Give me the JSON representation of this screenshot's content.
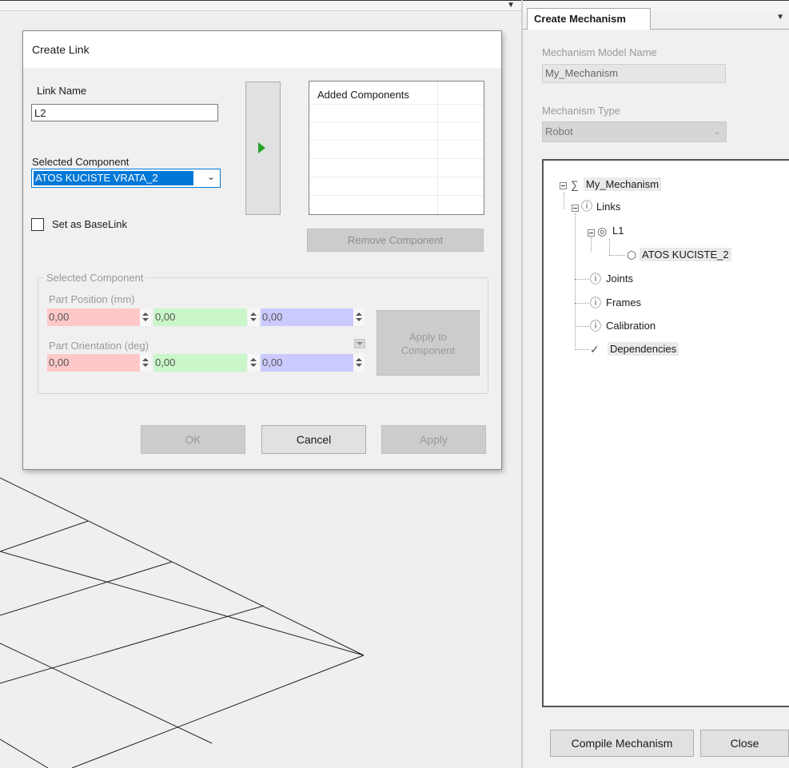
{
  "dialog": {
    "title": "Create Link",
    "link_name_label": "Link Name",
    "link_name_value": "L2",
    "selected_component_label": "Selected Component",
    "selected_component_value": "ATOS KUCISTE VRATA_2",
    "set_base_link_label": "Set as BaseLink",
    "set_base_link_checked": false,
    "added_components_header": "Added Components",
    "remove_component_label": "Remove Component",
    "group_title": "Selected Component",
    "part_position_label": "Part Position (mm)",
    "part_orientation_label": "Part Orientation (deg)",
    "position": {
      "x": "0,00",
      "y": "0,00",
      "z": "0,00"
    },
    "orientation": {
      "x": "0,00",
      "y": "0,00",
      "z": "0,00"
    },
    "apply_to_component_label_line1": "Apply to",
    "apply_to_component_label_line2": "Component",
    "ok_label": "OK",
    "cancel_label": "Cancel",
    "apply_label": "Apply"
  },
  "panel": {
    "tab_label": "Create Mechanism",
    "model_name_label": "Mechanism Model Name",
    "model_name_value": "My_Mechanism",
    "type_label": "Mechanism Type",
    "type_value": "Robot",
    "tree": {
      "root": "My_Mechanism",
      "links": "Links",
      "link_l1": "L1",
      "component": "ATOS KUCISTE_2",
      "joints": "Joints",
      "frames": "Frames",
      "calibration": "Calibration",
      "dependencies": "Dependencies"
    },
    "compile_label": "Compile Mechanism",
    "close_label": "Close"
  },
  "colors": {
    "accent": "#0078d7",
    "add_arrow": "#26a326",
    "x_field": "#ffc8c8",
    "y_field": "#c9f7c9",
    "z_field": "#cbcaff"
  }
}
